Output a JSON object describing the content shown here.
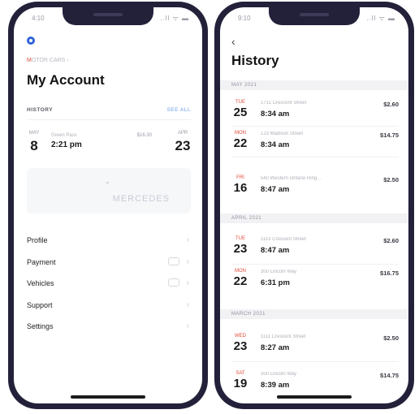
{
  "left": {
    "status_time": "4:10",
    "status_icons": "..ll ᯤ ▬",
    "breadcrumb_accent": "M",
    "breadcrumb": "OTOR CARS ›",
    "title": "My Account",
    "history_label": "HISTORY",
    "see_all": "SEE ALL",
    "recent": {
      "month": "MAY",
      "day": "8",
      "location": "Green Pass",
      "time": "2:21 pm",
      "amount": "$16.30",
      "month2": "APR",
      "day2": "23"
    },
    "vehicle_label": "MERCEDES",
    "menu": [
      {
        "label": "Profile"
      },
      {
        "label": "Payment"
      },
      {
        "label": "Vehicles"
      },
      {
        "label": "Support"
      },
      {
        "label": "Settings"
      }
    ]
  },
  "right": {
    "status_time": "9:10",
    "status_icons": "..ll ᯤ ▬",
    "title": "History",
    "sections": [
      {
        "label": "MAY 2021",
        "rows": [
          {
            "mon": "TUE",
            "day": "25",
            "loc": "1711 Crescent Street",
            "time": "8:34 am",
            "amt": "$2.60"
          },
          {
            "mon": "MON",
            "day": "22",
            "loc": "123 Madison Street",
            "time": "8:34 am",
            "amt": "$14.75"
          },
          {
            "mon": "FRI",
            "day": "16",
            "loc": "540 Western Ontario Ring...",
            "time": "8:47 am",
            "amt": "$2.50"
          }
        ]
      },
      {
        "label": "APRIL 2021",
        "rows": [
          {
            "mon": "TUE",
            "day": "23",
            "loc": "1113 Crescent Street",
            "time": "8:47 am",
            "amt": "$2.60"
          },
          {
            "mon": "MON",
            "day": "22",
            "loc": "300 Lincoln Way",
            "time": "6:31 pm",
            "amt": "$16.75"
          }
        ]
      },
      {
        "label": "MARCH 2021",
        "rows": [
          {
            "mon": "WED",
            "day": "23",
            "loc": "1111 Crescent Street",
            "time": "8:27 am",
            "amt": "$2.50"
          },
          {
            "mon": "SAT",
            "day": "19",
            "loc": "300 Lincoln Way",
            "time": "8:39 am",
            "amt": "$14.75"
          }
        ]
      }
    ]
  }
}
